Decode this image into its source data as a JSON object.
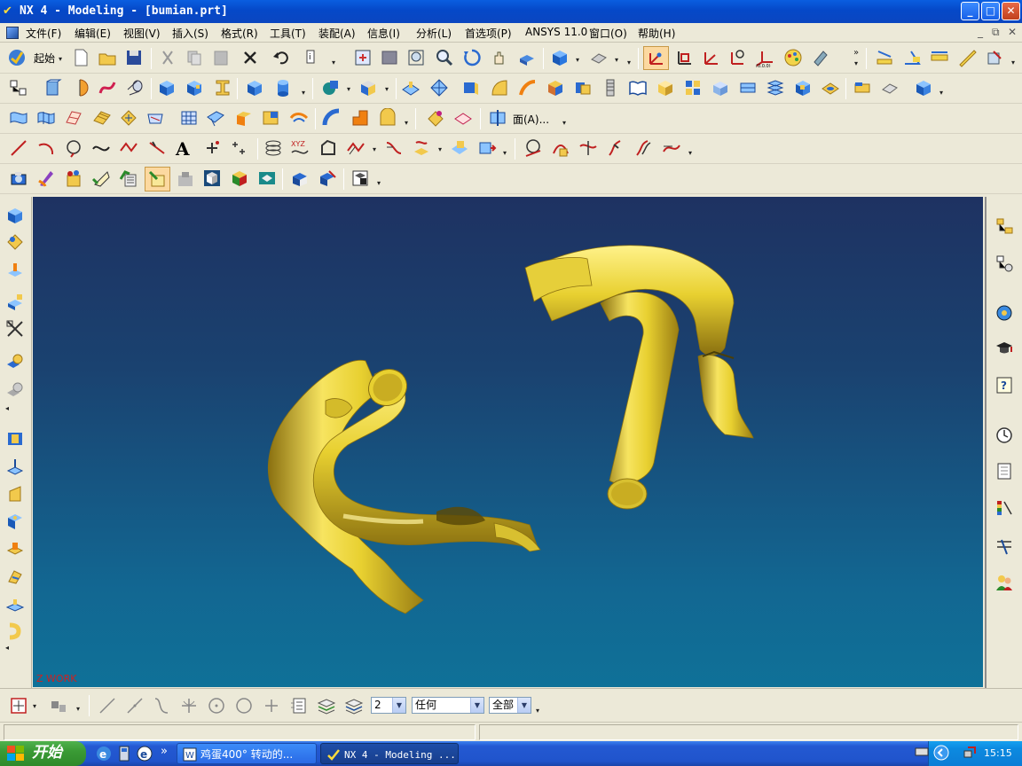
{
  "window": {
    "title": "NX 4 - Modeling - [bumian.prt]",
    "min_label": "_",
    "max_label": "□",
    "close_label": "✕"
  },
  "menu": {
    "items": [
      "文件(F)",
      "编辑(E)",
      "视图(V)",
      "插入(S)",
      "格式(R)",
      "工具(T)",
      "装配(A)",
      "信息(I)",
      "分析(L)",
      "首选项(P)",
      "ANSYS 11.0",
      "窗口(O)",
      "帮助(H)"
    ],
    "mdi_controls": [
      "_",
      "⧉",
      "✕"
    ]
  },
  "toolbar": {
    "start_label": "起始",
    "face_label": "面(A)..."
  },
  "viewport": {
    "work_label": "Z WORK",
    "bg_top": "#1e3262",
    "bg_bottom": "#0f7198",
    "model_color": "#e8d030"
  },
  "selection_bar": {
    "layer_value": "2",
    "type_value": "任何",
    "scope_value": "全部"
  },
  "taskbar": {
    "start_label": "开始",
    "more_label": "»",
    "buttons": [
      "鸡蛋400° 转动的...",
      "NX 4 - Modeling ..."
    ],
    "clock": "15:15"
  }
}
